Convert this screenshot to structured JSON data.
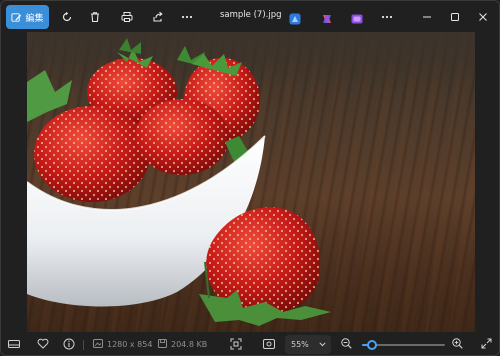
{
  "toolbar": {
    "edit_label": "編集",
    "file_title": "sample (7).jpg"
  },
  "image": {
    "alt": "strawberries in a white bowl on a wooden table"
  },
  "statusbar": {
    "dimensions": "1280 x 854",
    "file_size": "204.8 KB",
    "zoom": "55%",
    "zoom_level": 0.12
  },
  "colors": {
    "accent": "#3b8ed8",
    "slider": "#4aa3f0",
    "background": "#202020"
  }
}
